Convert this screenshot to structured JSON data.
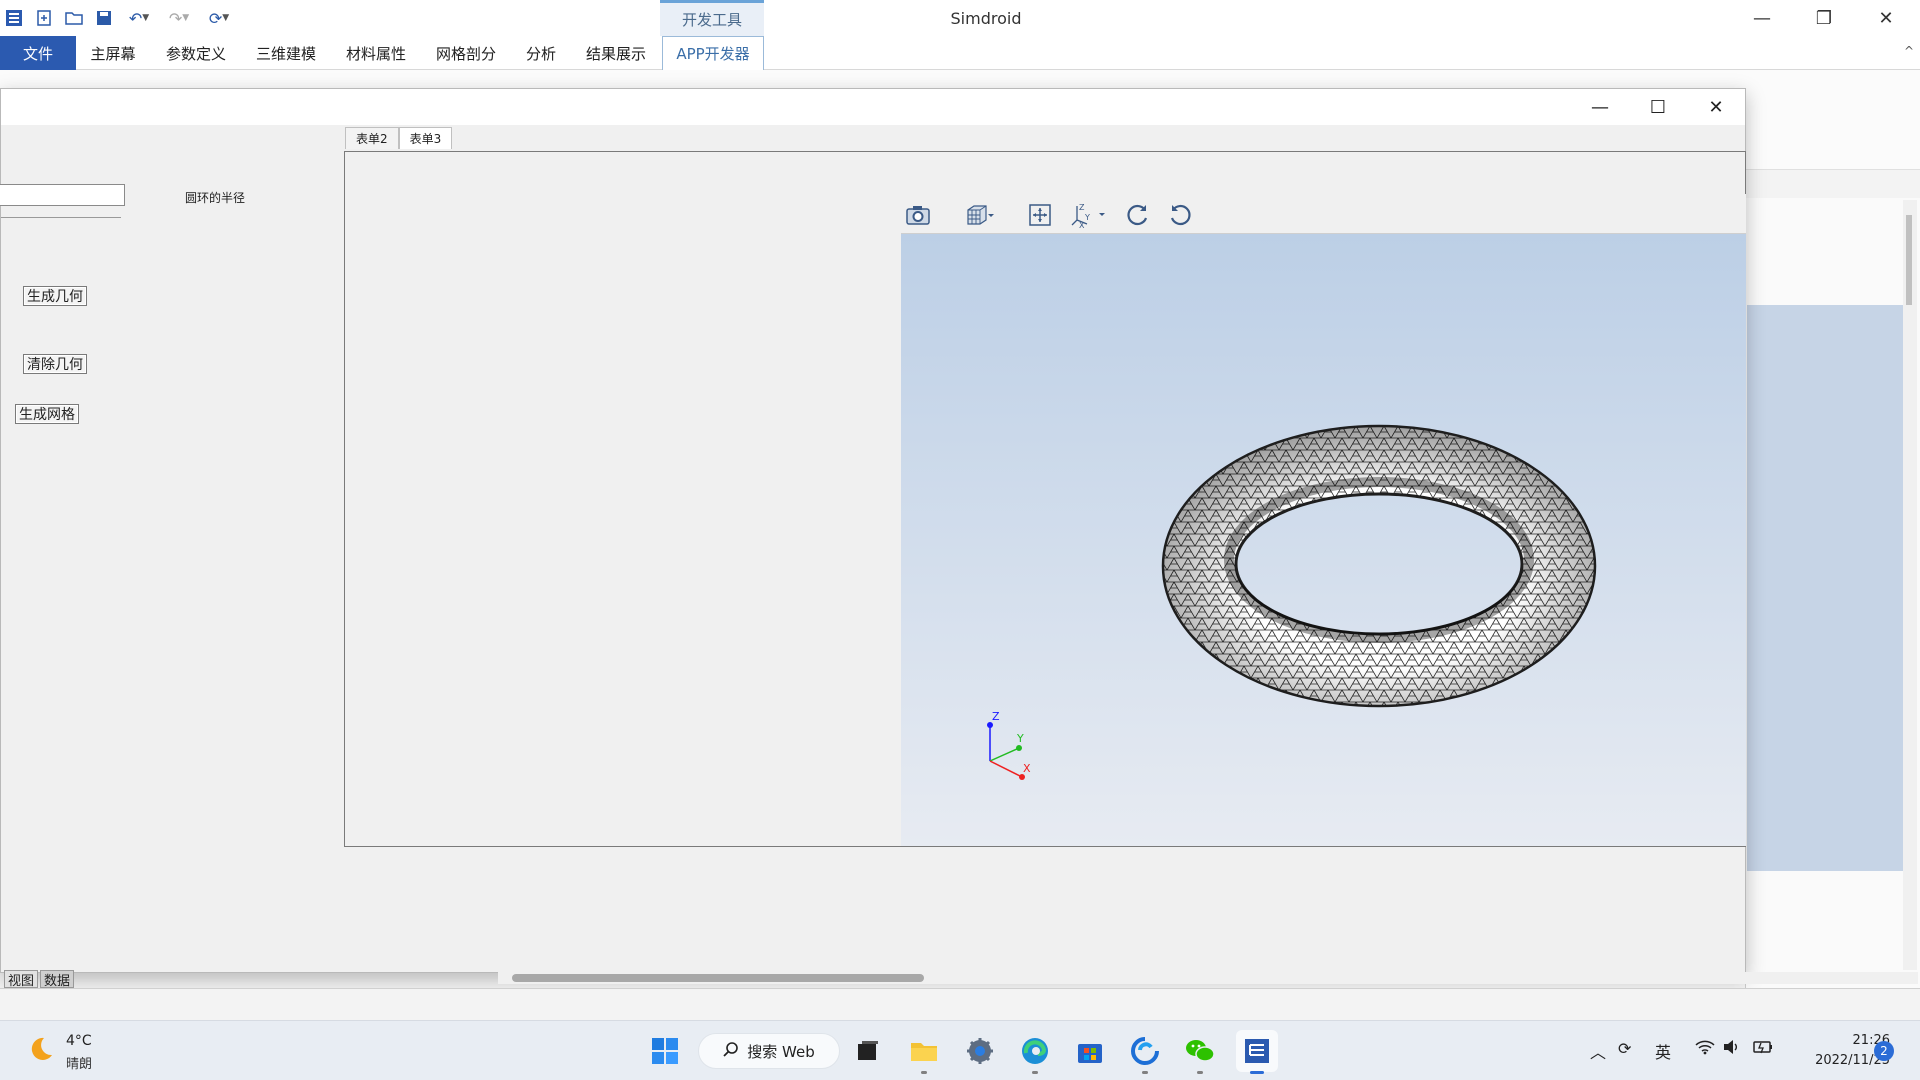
{
  "app": {
    "title": "Simdroid",
    "context_tab": "开发工具"
  },
  "ribbon": {
    "tabs": [
      {
        "label": "文件"
      },
      {
        "label": "主屏幕"
      },
      {
        "label": "参数定义"
      },
      {
        "label": "三维建模"
      },
      {
        "label": "材料属性"
      },
      {
        "label": "网格剖分"
      },
      {
        "label": "分析"
      },
      {
        "label": "结果展示"
      },
      {
        "label": "APP开发器"
      }
    ]
  },
  "dialog": {
    "param_label": "圆环的半径",
    "param_value": "",
    "buttons": {
      "generate_geometry": "生成几何",
      "clear_geometry": "清除几何",
      "generate_mesh": "生成网格"
    },
    "form_tabs": [
      {
        "label": "表单2"
      },
      {
        "label": "表单3"
      }
    ]
  },
  "viewer": {
    "toolbar": [
      "camera-icon",
      "view-cube-icon",
      "fit-view-icon",
      "axes-icon",
      "rotate-cw-icon",
      "rotate-ccw-icon"
    ],
    "axes": {
      "z": "Z",
      "y": "Y",
      "x": "X"
    },
    "model": "torus-mesh"
  },
  "bottom_panel": {
    "tabs": [
      {
        "label": "视图"
      },
      {
        "label": "数据"
      }
    ]
  },
  "taskbar": {
    "weather": {
      "temp": "4°C",
      "desc": "晴朗"
    },
    "search_label": "搜索 Web",
    "tray": {
      "ime": "英"
    },
    "clock": {
      "time": "21:26",
      "date": "2022/11/25"
    },
    "notification_count": "2"
  },
  "colors": {
    "accent": "#2b5ab0",
    "viewer_top": "#bccfe6",
    "viewer_bottom": "#e7ebf2"
  }
}
